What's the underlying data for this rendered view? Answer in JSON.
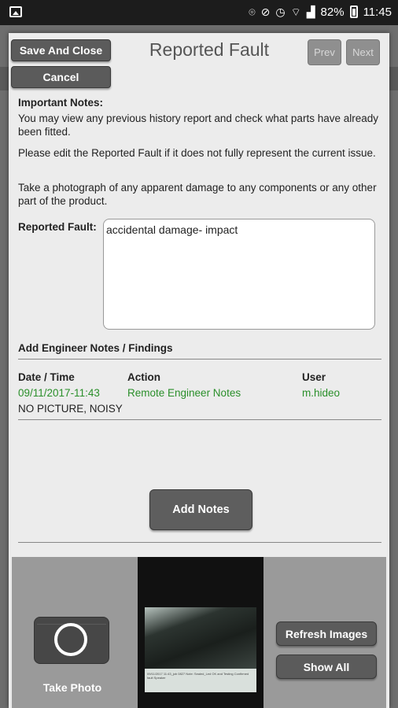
{
  "status_bar": {
    "battery": "82%",
    "time": "11:45"
  },
  "header": {
    "save_close_label": "Save And Close",
    "cancel_label": "Cancel",
    "title": "Reported Fault",
    "prev_label": "Prev",
    "next_label": "Next"
  },
  "important_notes": {
    "heading": "Important Notes:",
    "lines": [
      "You may view any previous history report and check what parts have already been fitted.",
      "Please edit the Reported Fault if it does not fully represent the current issue.",
      "Take a photograph of any apparent damage to any components or any other part of the product."
    ]
  },
  "reported_fault": {
    "label": "Reported Fault:",
    "value": "accidental damage- impact"
  },
  "engineer_notes": {
    "heading": "Add Engineer Notes / Findings",
    "columns": [
      "Date / Time",
      "Action",
      "User"
    ],
    "rows": [
      {
        "datetime": "09/11/2017-11:43",
        "action": "Remote Engineer Notes",
        "user": "m.hideo",
        "description": "NO PICTURE, NOISY"
      }
    ],
    "add_button": "Add Notes"
  },
  "photo_panel": {
    "take_photo_label": "Take Photo",
    "refresh_label": "Refresh Images",
    "show_all_label": "Show All",
    "thumbnail_caption": "09/11/2017 11:43_job 0827 Note: Sealed_Led OK and Testing Confirmed fault Speaker"
  },
  "colors": {
    "accent_green": "#2a8f2a",
    "button_gray": "#5b5b5b",
    "dialog_bg": "#ececec"
  }
}
